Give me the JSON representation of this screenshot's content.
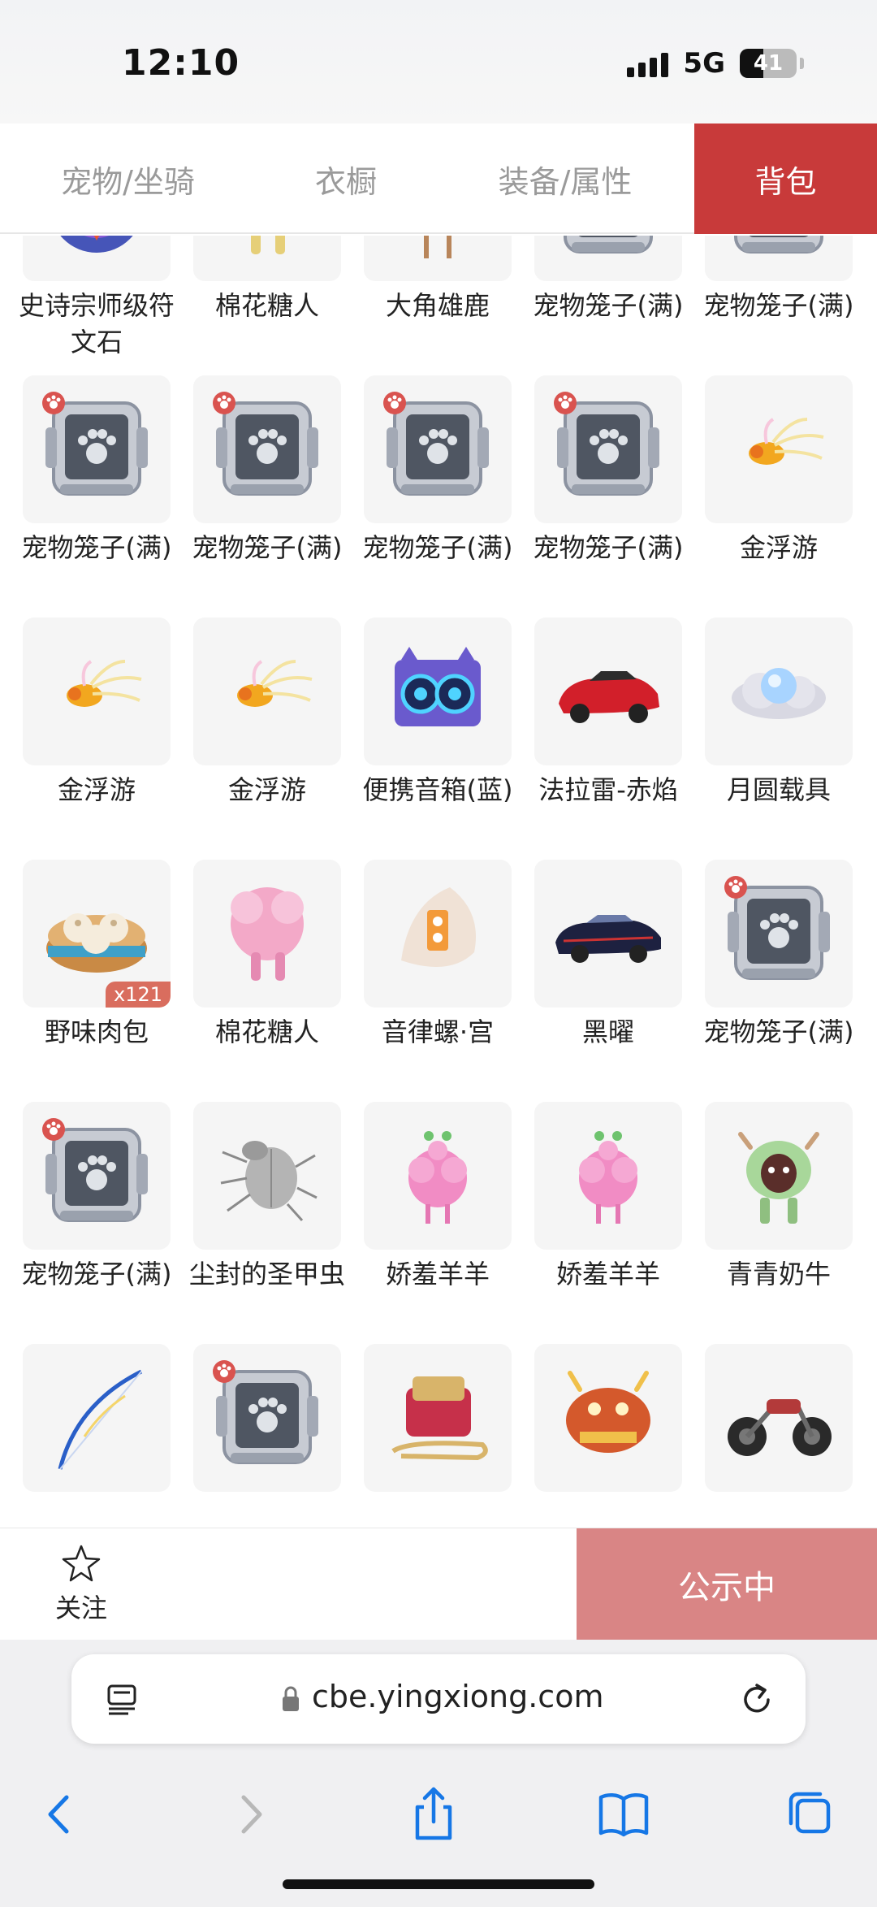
{
  "status": {
    "time": "12:10",
    "network": "5G",
    "battery": "41",
    "battery_level": 0.41
  },
  "tabs": [
    {
      "label": "宠物/坐骑"
    },
    {
      "label": "衣橱"
    },
    {
      "label": "装备/属性"
    },
    {
      "label": "背包",
      "active": true
    }
  ],
  "items": [
    {
      "name": "史诗宗师级符文石",
      "icon": "rune-stone-icon"
    },
    {
      "name": "棉花糖人",
      "icon": "cotton-candy-creature-icon"
    },
    {
      "name": "大角雄鹿",
      "icon": "deer-icon"
    },
    {
      "name": "宠物笼子(满)",
      "icon": "pet-cage-icon"
    },
    {
      "name": "宠物笼子(满)",
      "icon": "pet-cage-icon"
    },
    {
      "name": "宠物笼子(满)",
      "icon": "pet-cage-icon"
    },
    {
      "name": "宠物笼子(满)",
      "icon": "pet-cage-icon"
    },
    {
      "name": "宠物笼子(满)",
      "icon": "pet-cage-icon"
    },
    {
      "name": "宠物笼子(满)",
      "icon": "pet-cage-icon"
    },
    {
      "name": "金浮游",
      "icon": "golden-floater-icon"
    },
    {
      "name": "金浮游",
      "icon": "golden-floater-icon"
    },
    {
      "name": "金浮游",
      "icon": "golden-floater-icon"
    },
    {
      "name": "便携音箱(蓝)",
      "icon": "speaker-icon"
    },
    {
      "name": "法拉雷-赤焰",
      "icon": "red-car-icon"
    },
    {
      "name": "月圆载具",
      "icon": "moon-cloud-icon"
    },
    {
      "name": "野味肉包",
      "icon": "bun-steamer-icon",
      "count": "x121"
    },
    {
      "name": "棉花糖人",
      "icon": "pink-cotton-creature-icon"
    },
    {
      "name": "音律螺·宫",
      "icon": "conch-icon"
    },
    {
      "name": "黑曜",
      "icon": "black-car-icon"
    },
    {
      "name": "宠物笼子(满)",
      "icon": "pet-cage-icon"
    },
    {
      "name": "宠物笼子(满)",
      "icon": "pet-cage-icon"
    },
    {
      "name": "尘封的圣甲虫",
      "icon": "beetle-icon"
    },
    {
      "name": "娇羞羊羊",
      "icon": "pink-sheep-icon"
    },
    {
      "name": "娇羞羊羊",
      "icon": "pink-sheep-icon"
    },
    {
      "name": "青青奶牛",
      "icon": "green-cow-icon"
    },
    {
      "name": "",
      "icon": "bow-icon"
    },
    {
      "name": "",
      "icon": "pet-cage-icon"
    },
    {
      "name": "",
      "icon": "sleigh-icon"
    },
    {
      "name": "",
      "icon": "dragon-cart-icon"
    },
    {
      "name": "",
      "icon": "motorcycle-icon"
    }
  ],
  "bottom": {
    "follow_label": "关注",
    "publicity_label": "公示中"
  },
  "browser": {
    "url": "cbe.yingxiong.com"
  },
  "colors": {
    "accent_red": "#c83a3a",
    "publicity_bg": "#d98585",
    "badge": "#d96d5e"
  }
}
